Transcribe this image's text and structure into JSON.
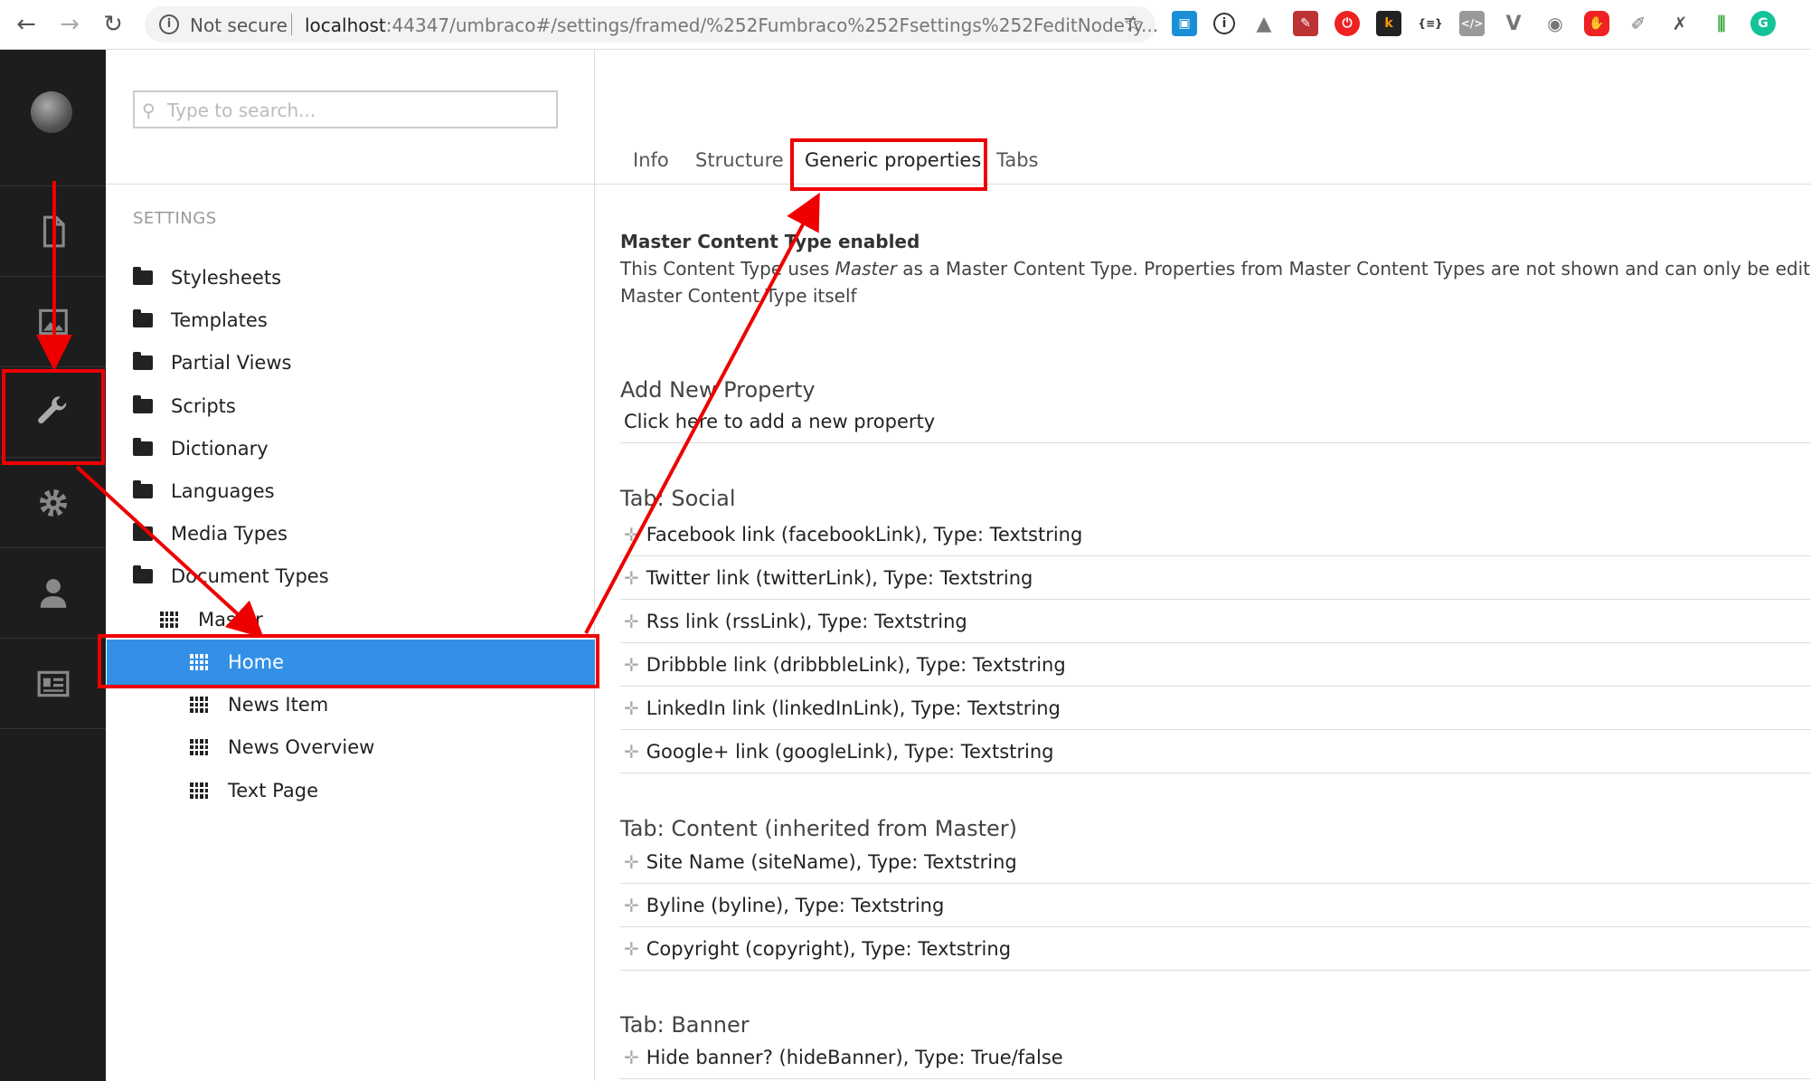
{
  "browser": {
    "security_label": "Not secure",
    "url_host": "localhost",
    "url_path": ":44347/umbraco#/settings/framed/%252Fumbraco%252Fsettings%252FeditNodeTy..."
  },
  "tree": {
    "search_placeholder": "Type to search...",
    "section_title": "SETTINGS",
    "folders": [
      {
        "label": "Stylesheets"
      },
      {
        "label": "Templates"
      },
      {
        "label": "Partial Views"
      },
      {
        "label": "Scripts"
      },
      {
        "label": "Dictionary"
      },
      {
        "label": "Languages"
      },
      {
        "label": "Media Types"
      },
      {
        "label": "Document Types"
      }
    ],
    "doc_types": {
      "master": "Master",
      "children": [
        {
          "label": "Home",
          "selected": true
        },
        {
          "label": "News Item"
        },
        {
          "label": "News Overview"
        },
        {
          "label": "Text Page"
        }
      ]
    }
  },
  "main": {
    "tabs": [
      {
        "label": "Info"
      },
      {
        "label": "Structure"
      },
      {
        "label": "Generic properties",
        "active": true
      },
      {
        "label": "Tabs"
      }
    ],
    "master_notice": {
      "title": "Master Content Type enabled",
      "line1_pre": "This Content Type uses ",
      "line1_em": "Master",
      "line1_post": " as a Master Content Type. Properties from Master Content Types are not shown and can only be edited",
      "line2": "Master Content Type itself"
    },
    "add_property": {
      "title": "Add New Property",
      "link": "Click here to add a new property"
    },
    "groups": [
      {
        "title": "Tab: Social",
        "properties": [
          "Facebook link (facebookLink), Type: Textstring",
          "Twitter link (twitterLink), Type: Textstring",
          "Rss link (rssLink), Type: Textstring",
          "Dribbble link (dribbbleLink), Type: Textstring",
          "LinkedIn link (linkedInLink), Type: Textstring",
          "Google+ link (googleLink), Type: Textstring"
        ]
      },
      {
        "title": "Tab: Content (inherited from Master)",
        "properties": [
          "Site Name (siteName), Type: Textstring",
          "Byline (byline), Type: Textstring",
          "Copyright (copyright), Type: Textstring"
        ]
      },
      {
        "title": "Tab: Banner",
        "properties": [
          "Hide banner? (hideBanner), Type: True/false"
        ]
      }
    ]
  },
  "colors": {
    "annotation": "#e00000",
    "selected_node": "#3390e6",
    "app_bar": "#1d1d1d"
  }
}
